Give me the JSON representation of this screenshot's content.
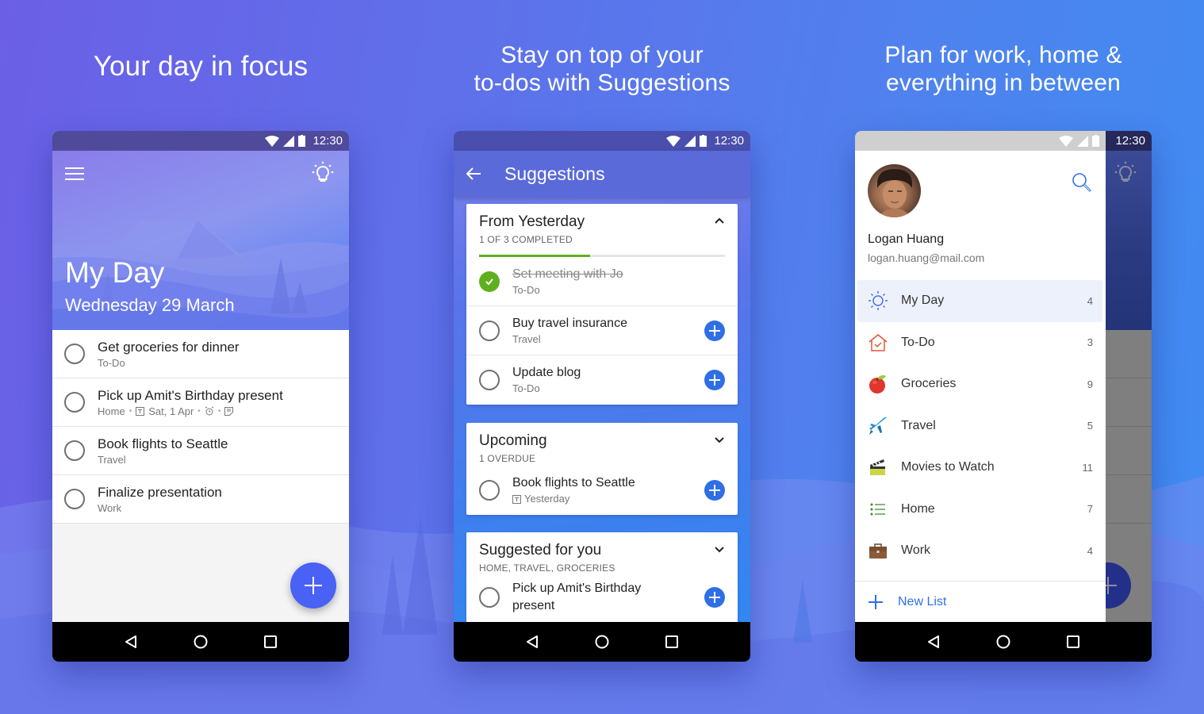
{
  "headlines": {
    "left": "Your day in focus",
    "center_line1": "Stay on top of your",
    "center_line2": "to-dos with Suggestions",
    "right_line1": "Plan for work, home &",
    "right_line2": "everything in between"
  },
  "status_bar": {
    "time": "12:30"
  },
  "my_day": {
    "title": "My Day",
    "date": "Wednesday 29 March",
    "tasks": [
      {
        "title": "Get groceries for dinner",
        "list": "To-Do"
      },
      {
        "title": "Pick up Amit's Birthday present",
        "list": "Home",
        "due": "Sat, 1 Apr",
        "has_reminder": true,
        "has_note": true
      },
      {
        "title": "Book flights to Seattle",
        "list": "Travel"
      },
      {
        "title": "Finalize presentation",
        "list": "Work"
      }
    ]
  },
  "suggestions": {
    "title": "Suggestions",
    "sections": [
      {
        "title": "From Yesterday",
        "subtitle": "1 OF 3 COMPLETED",
        "progress": 0.45,
        "expanded": true,
        "items": [
          {
            "title": "Set meeting with Jo",
            "list": "To-Do",
            "completed": true
          },
          {
            "title": "Buy travel insurance",
            "list": "Travel",
            "completed": false
          },
          {
            "title": "Update blog",
            "list": "To-Do",
            "completed": false
          }
        ]
      },
      {
        "title": "Upcoming",
        "subtitle": "1 OVERDUE",
        "expanded": false,
        "items": [
          {
            "title": "Book flights to Seattle",
            "due": "Yesterday",
            "completed": false
          }
        ]
      },
      {
        "title": "Suggested for you",
        "subtitle": "HOME, TRAVEL, GROCERIES",
        "expanded": false,
        "items": [
          {
            "title_line1": "Pick up Amit's Birthday",
            "title_line2": "present",
            "completed": false
          }
        ]
      }
    ]
  },
  "drawer": {
    "user_name": "Logan Huang",
    "user_email": "logan.huang@mail.com",
    "lists": [
      {
        "label": "My Day",
        "count": "4",
        "icon": "sun-icon",
        "active": true
      },
      {
        "label": "To-Do",
        "count": "3",
        "icon": "house-check-icon"
      },
      {
        "label": "Groceries",
        "count": "9",
        "icon": "apple-icon"
      },
      {
        "label": "Travel",
        "count": "5",
        "icon": "airplane-icon"
      },
      {
        "label": "Movies to Watch",
        "count": "11",
        "icon": "clapperboard-icon"
      },
      {
        "label": "Home",
        "count": "7",
        "icon": "list-icon"
      },
      {
        "label": "Work",
        "count": "4",
        "icon": "briefcase-icon"
      }
    ],
    "new_list_label": "New List"
  },
  "colors": {
    "accent_blue": "#2e6fe6",
    "fab_blue": "#4961f4",
    "complete_green": "#5fb01f"
  }
}
